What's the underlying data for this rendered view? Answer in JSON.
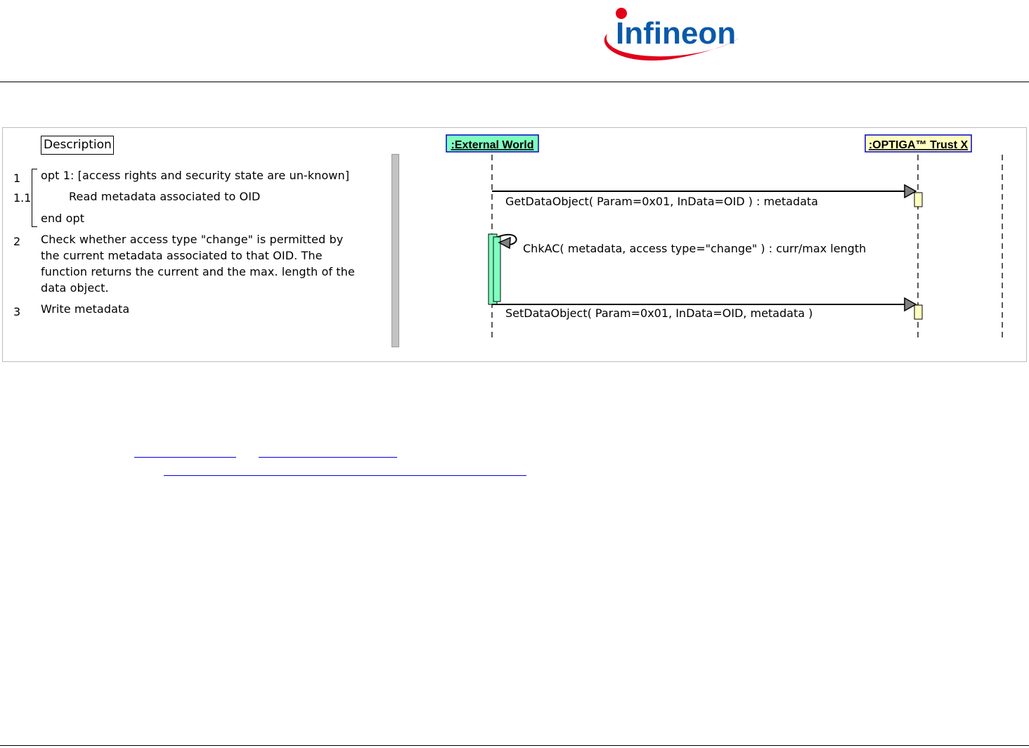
{
  "header": {
    "logo_text": "Infineon",
    "brand_colors": {
      "logo_swoosh": "#e2001a",
      "logo_text": "#0a5aa8"
    }
  },
  "description": {
    "title": "Description",
    "steps": [
      {
        "num": "1",
        "text": "opt 1: [access rights and security state are un-known]"
      },
      {
        "num": "1.1",
        "text": "Read metadata associated to OID"
      },
      {
        "num": "",
        "text": "end opt"
      },
      {
        "num": "2",
        "lines": [
          "Check whether access type \"change\" is permitted by",
          "the current metadata associated to that OID. The",
          "function returns the current and the max. length of the",
          "data object."
        ]
      },
      {
        "num": "3",
        "text": "Write metadata"
      }
    ]
  },
  "sequence": {
    "participants": [
      {
        "name": ":External World",
        "color": "#7fffbf"
      },
      {
        "name": ":OPTIGA™ Trust X",
        "color": "#ffffc0"
      }
    ],
    "messages": [
      {
        "label": "GetDataObject( Param=0x01, InData=OID ) : metadata"
      },
      {
        "label": "ChkAC( metadata, access type=\"change\" ) : curr/max length"
      },
      {
        "label": "SetDataObject( Param=0x01, InData=OID, metadata )"
      }
    ]
  }
}
